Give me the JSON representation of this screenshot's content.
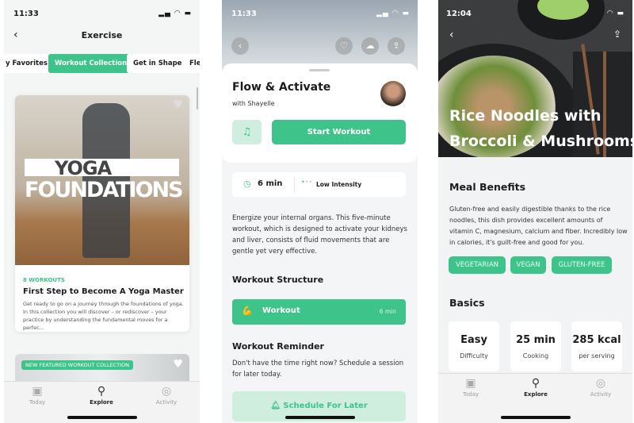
{
  "accent": "#3ec38a",
  "screen1": {
    "time": "11:33",
    "title": "Exercise",
    "chips": [
      "y Favorites",
      "Workout Collections",
      "Get in Shape",
      "Flex"
    ],
    "card": {
      "hero_line1": "YOGA",
      "hero_line2": "FOUNDATIONS",
      "count": "8 WORKOUTS",
      "title": "First Step to Become A Yoga Master",
      "desc": "Get ready to go on a journey through the foundations of yoga. In this collection you will discover – or rediscover – your practice by understanding the fundamental moves for a perfec..."
    },
    "card2_badge": "NEW FEATURED WORKOUT COLLECTION"
  },
  "screen2": {
    "time": "11:33",
    "title": "Flow & Activate",
    "subtitle": "with Shayelle",
    "start": "Start Workout",
    "duration": "6 min",
    "intensity": "Low Intensity",
    "description": "Energize your internal organs. This five-minute workout, which is designed to activate your kidneys and liver, consists of fluid movements that are gentle yet very effective.",
    "structure_heading": "Workout Structure",
    "structure_item": "Workout",
    "structure_time": "6 min",
    "reminder_heading": "Workout Reminder",
    "reminder_text": "Don't have the time right now? Schedule a session for later today.",
    "schedule": "Schedule For Later"
  },
  "screen3": {
    "time": "12:04",
    "title_line1": "Rice Noodles with",
    "title_line2": "Broccoli & Mushrooms",
    "benefits_heading": "Meal Benefits",
    "benefits_text": "Gluten-free and easily digestible thanks to the rice noodles, this dish provides excellent amounts of vitamin C, magnesium, calcium and fiber. Incredibly low in calories, it's guilt-free and good for you.",
    "tags": [
      "VEGETARIAN",
      "VEGAN",
      "GLUTEN-FREE"
    ],
    "basics_heading": "Basics",
    "basics": [
      {
        "value": "Easy",
        "label": "Difficulty"
      },
      {
        "value": "25 min",
        "label": "Cooking"
      },
      {
        "value": "285 kcal",
        "label": "per serving"
      }
    ]
  },
  "tabbar": [
    "Today",
    "Explore",
    "Activity"
  ]
}
